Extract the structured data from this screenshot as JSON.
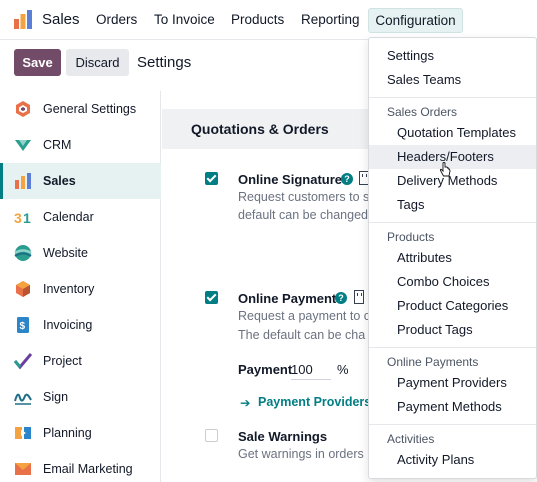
{
  "app": {
    "name": "Sales"
  },
  "nav": {
    "items": [
      "Orders",
      "To Invoice",
      "Products",
      "Reporting"
    ],
    "configuration": "Configuration"
  },
  "control": {
    "save": "Save",
    "discard": "Discard",
    "breadcrumb": "Settings"
  },
  "sidebar": {
    "items": [
      {
        "label": "General Settings",
        "icon": "general-settings-icon"
      },
      {
        "label": "CRM",
        "icon": "crm-icon"
      },
      {
        "label": "Sales",
        "icon": "sales-icon",
        "active": true
      },
      {
        "label": "Calendar",
        "icon": "calendar-icon"
      },
      {
        "label": "Website",
        "icon": "website-icon"
      },
      {
        "label": "Inventory",
        "icon": "inventory-icon"
      },
      {
        "label": "Invoicing",
        "icon": "invoicing-icon"
      },
      {
        "label": "Project",
        "icon": "project-icon"
      },
      {
        "label": "Sign",
        "icon": "sign-icon"
      },
      {
        "label": "Planning",
        "icon": "planning-icon"
      },
      {
        "label": "Email Marketing",
        "icon": "email-marketing-icon"
      }
    ]
  },
  "main": {
    "section_title": "Quotations & Orders",
    "online_signature": {
      "title": "Online Signature",
      "checked": true,
      "desc1": "Request customers to s",
      "desc2": "default can be changed"
    },
    "online_payment": {
      "title": "Online Payment",
      "checked": true,
      "desc1": "Request a payment to c",
      "desc2": "The default can be cha",
      "payment_label": "Payment",
      "payment_value": "100",
      "payment_unit": "%",
      "link": "Payment Providers"
    },
    "sale_warnings": {
      "title": "Sale Warnings",
      "checked": false,
      "desc1": "Get warnings in orders"
    }
  },
  "dropdown": {
    "top_items": [
      "Settings",
      "Sales Teams"
    ],
    "groups": [
      {
        "header": "Sales Orders",
        "items": [
          "Quotation Templates",
          "Headers/Footers",
          "Delivery Methods",
          "Tags"
        ]
      },
      {
        "header": "Products",
        "items": [
          "Attributes",
          "Combo Choices",
          "Product Categories",
          "Product Tags"
        ]
      },
      {
        "header": "Online Payments",
        "items": [
          "Payment Providers",
          "Payment Methods"
        ]
      },
      {
        "header": "Activities",
        "items": [
          "Activity Plans"
        ]
      }
    ],
    "hovered": "Headers/Footers"
  },
  "colors": {
    "brand": "#714b67",
    "accent": "#017e84",
    "active_bg": "#e6f2f2"
  }
}
